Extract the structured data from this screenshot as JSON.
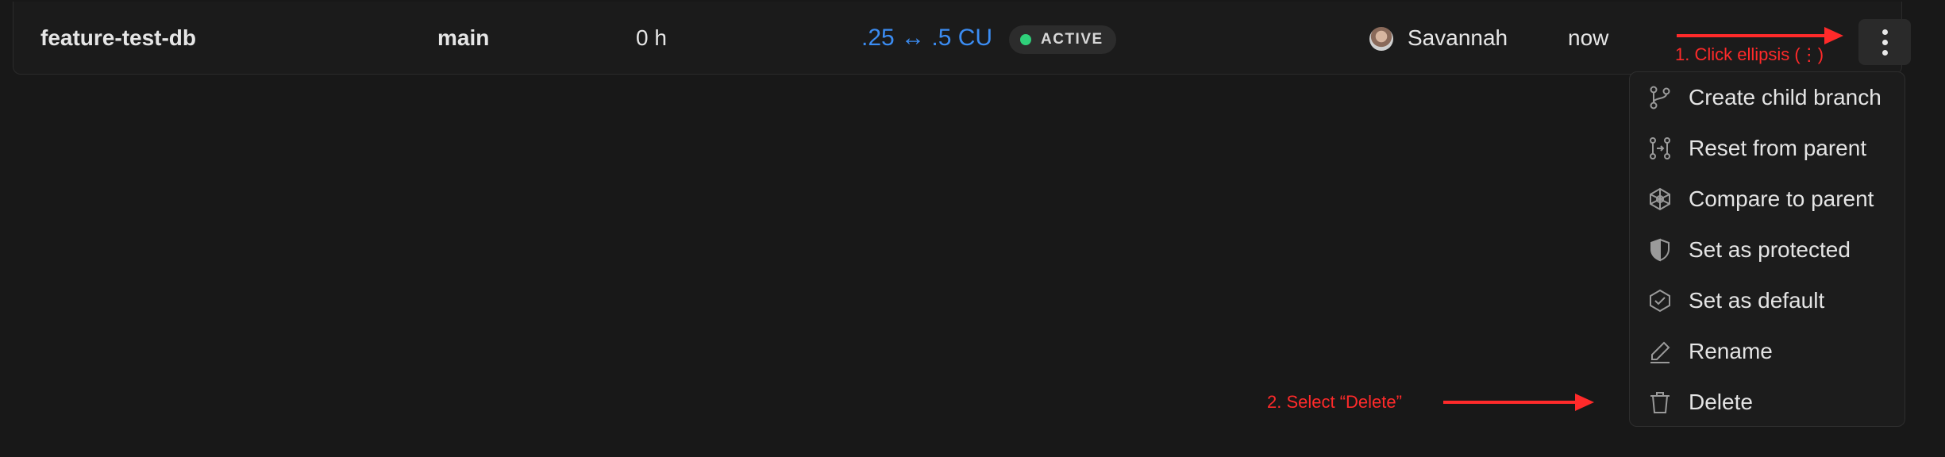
{
  "row": {
    "branch_name": "feature-test-db",
    "parent": "main",
    "hours": "0 h",
    "compute": ".25 ↔ .5 CU",
    "status": "ACTIVE",
    "user": "Savannah",
    "last_active": "now"
  },
  "menu": {
    "items": [
      {
        "label": "Create child branch",
        "icon": "branch-icon"
      },
      {
        "label": "Reset from parent",
        "icon": "reset-icon"
      },
      {
        "label": "Compare to parent",
        "icon": "compare-icon"
      },
      {
        "label": "Set as protected",
        "icon": "shield-icon"
      },
      {
        "label": "Set as default",
        "icon": "check-badge-icon"
      },
      {
        "label": "Rename",
        "icon": "pencil-icon"
      },
      {
        "label": "Delete",
        "icon": "trash-icon"
      }
    ]
  },
  "annotations": {
    "step1": "1. Click ellipsis (⋮)",
    "step2": "2. Select “Delete”"
  },
  "colors": {
    "background": "#181818",
    "compute_text": "#3b8cf2",
    "status_dot": "#2fd07a",
    "annotation": "#ff2a2a"
  }
}
